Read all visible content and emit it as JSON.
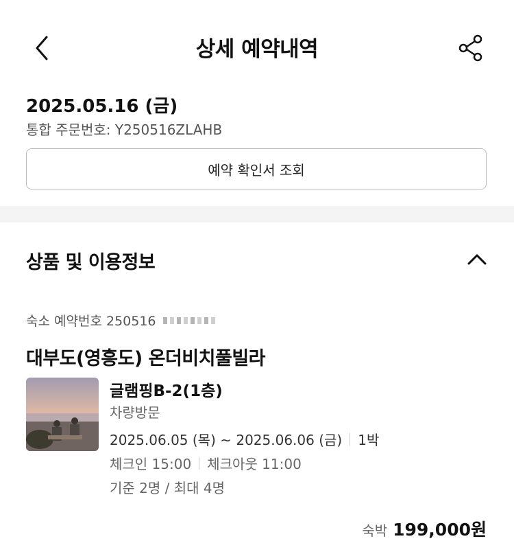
{
  "header": {
    "title": "상세 예약내역"
  },
  "order": {
    "date": "2025.05.16 (금)",
    "number": "통합 주문번호: Y250516ZLAHB",
    "confirm_button": "예약 확인서 조회"
  },
  "section": {
    "title": "상품 및 이용정보"
  },
  "reservation": {
    "number_label": "숙소 예약번호 250516",
    "property": "대부도(영흥도) 온더비치풀빌라",
    "room": "글램핑B-2(1층)",
    "visit_type": "차량방문",
    "date_range": "2025.06.05 (목) ~ 2025.06.06 (금)",
    "nights": "1박",
    "check_in": "체크인 15:00",
    "check_out": "체크아웃 11:00",
    "capacity": "기준 2명 / 최대 4명",
    "price_label": "숙박",
    "price": "199,000원"
  },
  "icons": {
    "back": "chevron-left-icon",
    "share": "share-icon",
    "collapse": "chevron-up-icon"
  }
}
